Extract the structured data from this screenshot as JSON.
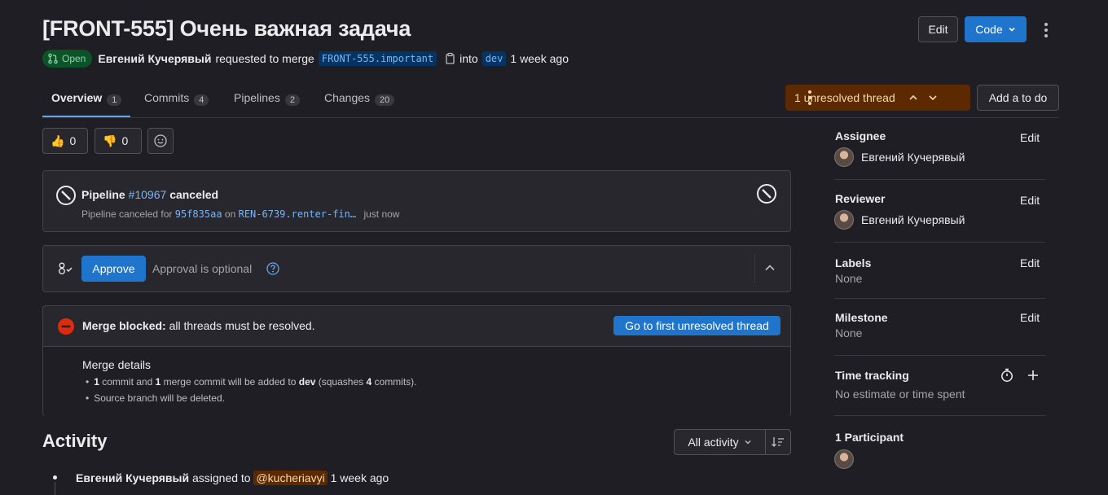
{
  "header": {
    "title": "[FRONT-555] Очень важная задача",
    "edit_label": "Edit",
    "code_label": "Code",
    "status_label": "Open",
    "author": "Евгений Кучерявый",
    "requested_text": "requested to merge",
    "source_branch": "FRONT-555.important",
    "into_text": "into",
    "target_branch": "dev",
    "time_ago": "1 week ago"
  },
  "tabs": [
    {
      "label": "Overview",
      "count": "1"
    },
    {
      "label": "Commits",
      "count": "4"
    },
    {
      "label": "Pipelines",
      "count": "2"
    },
    {
      "label": "Changes",
      "count": "20"
    }
  ],
  "threads": {
    "unresolved_label": "1 unresolved thread",
    "todo_label": "Add a to do"
  },
  "reactions": {
    "thumbs_up_emoji": "👍",
    "thumbs_up_count": "0",
    "thumbs_down_emoji": "👎",
    "thumbs_down_count": "0"
  },
  "pipeline": {
    "label": "Pipeline",
    "id": "#10967",
    "status": "canceled",
    "detail_prefix": "Pipeline canceled for",
    "commit": "95f835aa",
    "on_text": "on",
    "branch": "REN-6739.renter-fin…",
    "time": "just now"
  },
  "approval": {
    "approve_label": "Approve",
    "optional_text": "Approval is optional"
  },
  "merge": {
    "blocked_bold": "Merge blocked:",
    "blocked_text": "all threads must be resolved.",
    "goto_label": "Go to first unresolved thread",
    "details_title": "Merge details",
    "d1_n1": "1",
    "d1_t1": "commit and",
    "d1_n2": "1",
    "d1_t2": "merge commit will be added to",
    "d1_branch": "dev",
    "d1_t3": "(squashes",
    "d1_n3": "4",
    "d1_t4": "commits).",
    "d2": "Source branch will be deleted."
  },
  "activity": {
    "title": "Activity",
    "filter_label": "All activity",
    "entry_author": "Евгений Кучерявый",
    "entry_text": "assigned to",
    "entry_mention": "@kucheriavyi",
    "entry_time": "1 week ago"
  },
  "sidebar": {
    "assignee_label": "Assignee",
    "assignee_name": "Евгений Кучерявый",
    "reviewer_label": "Reviewer",
    "reviewer_name": "Евгений Кучерявый",
    "labels_label": "Labels",
    "labels_value": "None",
    "milestone_label": "Milestone",
    "milestone_value": "None",
    "time_label": "Time tracking",
    "time_value": "No estimate or time spent",
    "participants_label": "1 Participant",
    "edit_label": "Edit"
  },
  "colors": {
    "background": "#1f1e24",
    "accent": "#1f75cb",
    "open_badge": "#0d532a",
    "unresolved_bg": "#5c2900",
    "danger": "#dd2b0e"
  }
}
